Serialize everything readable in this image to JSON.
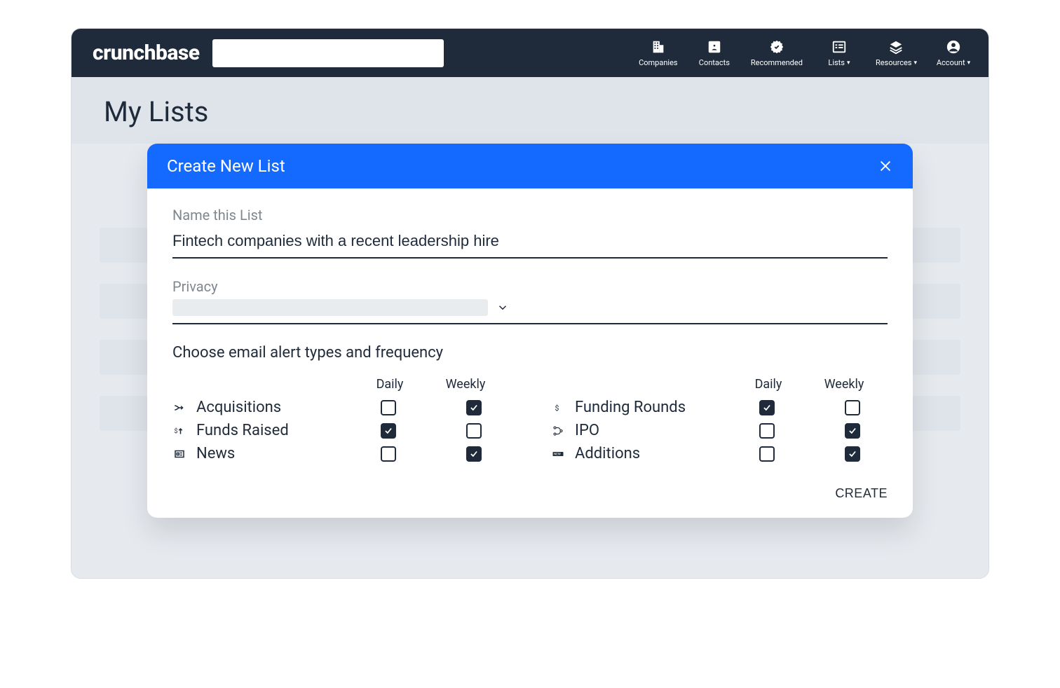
{
  "brand": "crunchbase",
  "nav": {
    "companies": "Companies",
    "contacts": "Contacts",
    "recommended": "Recommended",
    "lists": "Lists",
    "resources": "Resources",
    "account": "Account"
  },
  "page": {
    "title": "My Lists"
  },
  "modal": {
    "title": "Create New List",
    "name_label": "Name this List",
    "name_value": "Fintech companies with a recent leadership hire",
    "privacy_label": "Privacy",
    "alerts_section": "Choose email alert types and frequency",
    "col_daily": "Daily",
    "col_weekly": "Weekly",
    "create_button": "CREATE",
    "left_alerts": [
      {
        "name": "Acquisitions",
        "daily": false,
        "weekly": true
      },
      {
        "name": "Funds Raised",
        "daily": true,
        "weekly": false
      },
      {
        "name": "News",
        "daily": false,
        "weekly": true
      }
    ],
    "right_alerts": [
      {
        "name": "Funding Rounds",
        "daily": true,
        "weekly": false
      },
      {
        "name": "IPO",
        "daily": false,
        "weekly": true
      },
      {
        "name": "Additions",
        "daily": false,
        "weekly": true
      }
    ]
  }
}
